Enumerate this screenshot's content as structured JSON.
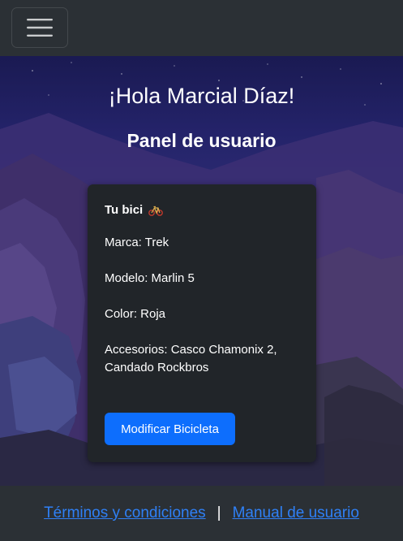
{
  "navbar": {
    "menu_icon": "hamburger-menu-icon"
  },
  "hero": {
    "greeting": "¡Hola Marcial Díaz!",
    "panel_title": "Panel de usuario"
  },
  "card": {
    "title": "Tu bici",
    "title_icon": "bicycle-icon",
    "brand": "Marca: Trek",
    "model": "Modelo: Marlin 5",
    "color": "Color: Roja",
    "accessories": "Accesorios: Casco Chamonix 2, Candado Rockbros",
    "button_label": "Modificar Bicicleta"
  },
  "footer": {
    "terms_link": "Términos y condiciones",
    "separator": "|",
    "manual_link": "Manual de usuario"
  },
  "colors": {
    "navbar_bg": "#2b3035",
    "card_bg": "#212529",
    "primary_button": "#0d6efd",
    "link": "#2f80f6"
  }
}
